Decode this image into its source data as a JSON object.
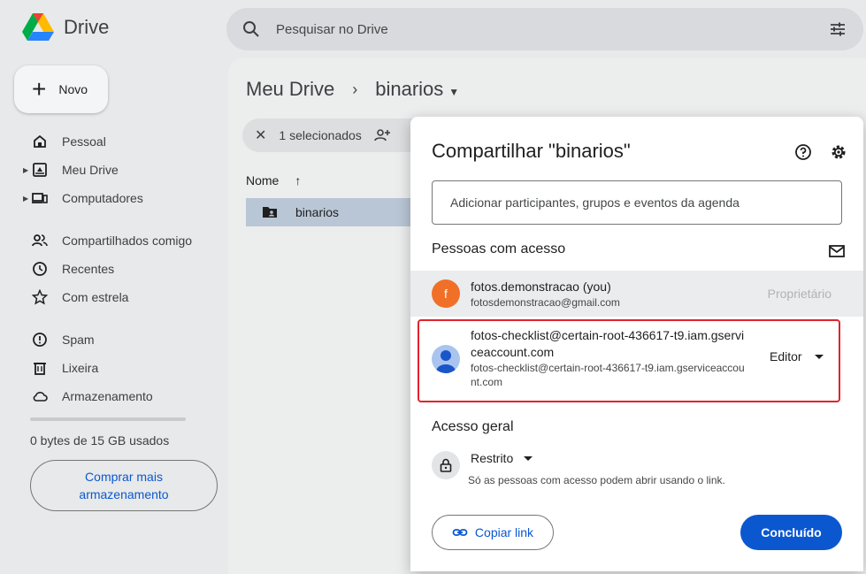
{
  "app": {
    "name": "Drive",
    "search_placeholder": "Pesquisar no Drive",
    "icons": {
      "search": "search-icon",
      "filter": "tune-icon",
      "logo": "drive-logo"
    }
  },
  "sidebar": {
    "new_label": "Novo",
    "items": [
      {
        "label": "Pessoal",
        "icon": "home-icon"
      },
      {
        "label": "Meu Drive",
        "icon": "drive-folder-icon"
      },
      {
        "label": "Computadores",
        "icon": "computer-icon"
      },
      {
        "label": "Compartilhados comigo",
        "icon": "people-icon"
      },
      {
        "label": "Recentes",
        "icon": "clock-icon"
      },
      {
        "label": "Com estrela",
        "icon": "star-icon"
      },
      {
        "label": "Spam",
        "icon": "spam-icon"
      },
      {
        "label": "Lixeira",
        "icon": "trash-icon"
      },
      {
        "label": "Armazenamento",
        "icon": "cloud-icon"
      }
    ],
    "storage_used_text": "0 bytes de 15 GB usados",
    "storage_fraction": 0,
    "buy_storage_label": "Comprar mais armazenamento"
  },
  "main": {
    "breadcrumb_root": "Meu Drive",
    "breadcrumb_current": "binarios",
    "selection_count": "1 selecionados",
    "column_name": "Nome",
    "files": [
      {
        "name": "binarios"
      }
    ]
  },
  "share_dialog": {
    "title": "Compartilhar \"binarios\"",
    "add_placeholder": "Adicionar participantes, grupos e eventos da agenda",
    "people_heading": "Pessoas com acesso",
    "people": [
      {
        "initial": "f",
        "name": "fotos.demonstracao (you)",
        "email": "fotosdemonstracao@gmail.com",
        "role": "Proprietário",
        "avatar_color": "#f07028"
      },
      {
        "name": "fotos-checklist@certain-root-436617-t9.iam.gserviceaccount.com",
        "email": "fotos-checklist@certain-root-436617-t9.iam.gserviceaccount.com",
        "role": "Editor",
        "avatar_color": "#aac4f0"
      }
    ],
    "general_heading": "Acesso geral",
    "general_access": "Restrito",
    "general_access_desc": "Só as pessoas com acesso podem abrir usando o link.",
    "copy_link_label": "Copiar link",
    "done_label": "Concluído",
    "highlight_color": "#e0242c",
    "accent_color": "#0b57d0"
  }
}
